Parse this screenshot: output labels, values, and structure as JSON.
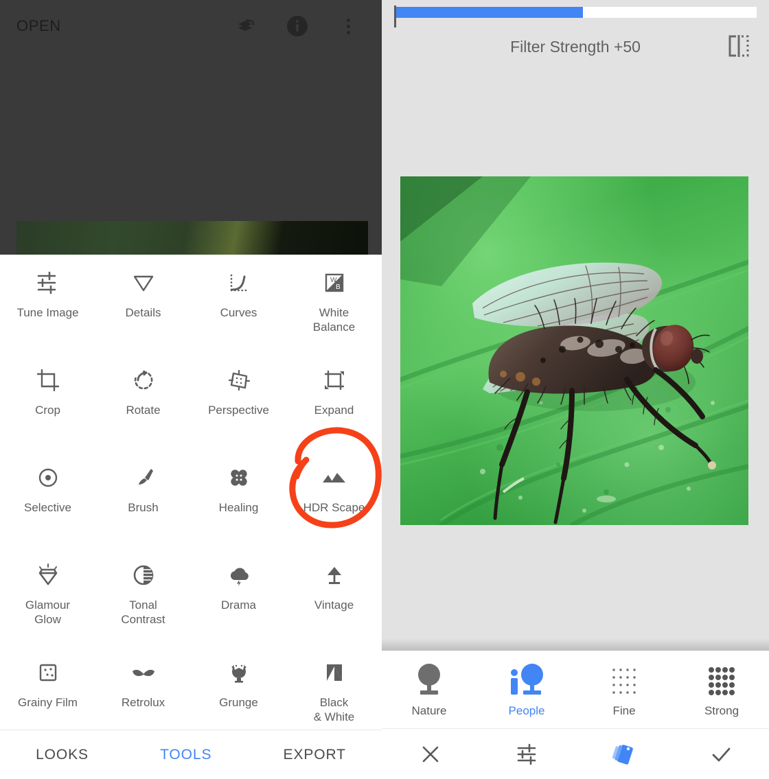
{
  "left": {
    "topbar": {
      "open_label": "OPEN",
      "icons": [
        {
          "name": "layers-undo-icon"
        },
        {
          "name": "info-icon"
        },
        {
          "name": "overflow-menu-icon"
        }
      ]
    },
    "tools": [
      {
        "label": "Tune Image",
        "icon": "tune-sliders-icon"
      },
      {
        "label": "Details",
        "icon": "triangle-down-icon"
      },
      {
        "label": "Curves",
        "icon": "curves-icon"
      },
      {
        "label": "White\nBalance",
        "icon": "white-balance-icon"
      },
      {
        "label": "Crop",
        "icon": "crop-icon"
      },
      {
        "label": "Rotate",
        "icon": "rotate-icon"
      },
      {
        "label": "Perspective",
        "icon": "perspective-icon"
      },
      {
        "label": "Expand",
        "icon": "expand-icon"
      },
      {
        "label": "Selective",
        "icon": "selective-target-icon"
      },
      {
        "label": "Brush",
        "icon": "brush-icon"
      },
      {
        "label": "Healing",
        "icon": "healing-bandage-icon"
      },
      {
        "label": "HDR Scape",
        "icon": "mountains-icon"
      },
      {
        "label": "Glamour\nGlow",
        "icon": "diamond-sparkle-icon"
      },
      {
        "label": "Tonal\nContrast",
        "icon": "contrast-circle-icon"
      },
      {
        "label": "Drama",
        "icon": "cloud-lightning-icon"
      },
      {
        "label": "Vintage",
        "icon": "lamp-icon"
      },
      {
        "label": "Grainy Film",
        "icon": "grain-dots-square-icon"
      },
      {
        "label": "Retrolux",
        "icon": "moustache-icon"
      },
      {
        "label": "Grunge",
        "icon": "grunge-skull-icon"
      },
      {
        "label": "Black\n& White",
        "icon": "black-white-icon"
      }
    ],
    "bottom_nav": [
      {
        "label": "LOOKS",
        "active": false
      },
      {
        "label": "TOOLS",
        "active": true
      },
      {
        "label": "EXPORT",
        "active": false
      }
    ],
    "annotation": {
      "shape": "hand-drawn-circle",
      "target": "HDR Scape",
      "color": "#f5411a"
    }
  },
  "right": {
    "slider": {
      "label": "Filter Strength +50",
      "value": 50,
      "fill_percent": 52,
      "fill_color": "#4285f4",
      "track_color": "#ffffff"
    },
    "compare_icon": "compare-split-icon",
    "photo": {
      "subject": "macro photo of a fly resting on a green leaf"
    },
    "presets": [
      {
        "label": "Nature",
        "icon": "tree-icon",
        "active": false
      },
      {
        "label": "People",
        "icon": "person-tree-icon",
        "active": true
      },
      {
        "label": "Fine",
        "icon": "fine-dots-icon",
        "active": false
      },
      {
        "label": "Strong",
        "icon": "strong-dots-icon",
        "active": false
      }
    ],
    "bottom_bar": [
      {
        "name": "cancel-button",
        "icon": "close-x-icon",
        "active": false
      },
      {
        "name": "adjust-button",
        "icon": "tune-sliders-icon",
        "active": false
      },
      {
        "name": "looks-stack-button",
        "icon": "stack-cards-icon",
        "active": true
      },
      {
        "name": "apply-button",
        "icon": "checkmark-icon",
        "active": false
      }
    ]
  },
  "colors": {
    "accent_blue": "#4285f4",
    "dark_header": "#3a3a3a",
    "panel_gray": "#e2e2e2",
    "annotation_red": "#f5411a"
  }
}
